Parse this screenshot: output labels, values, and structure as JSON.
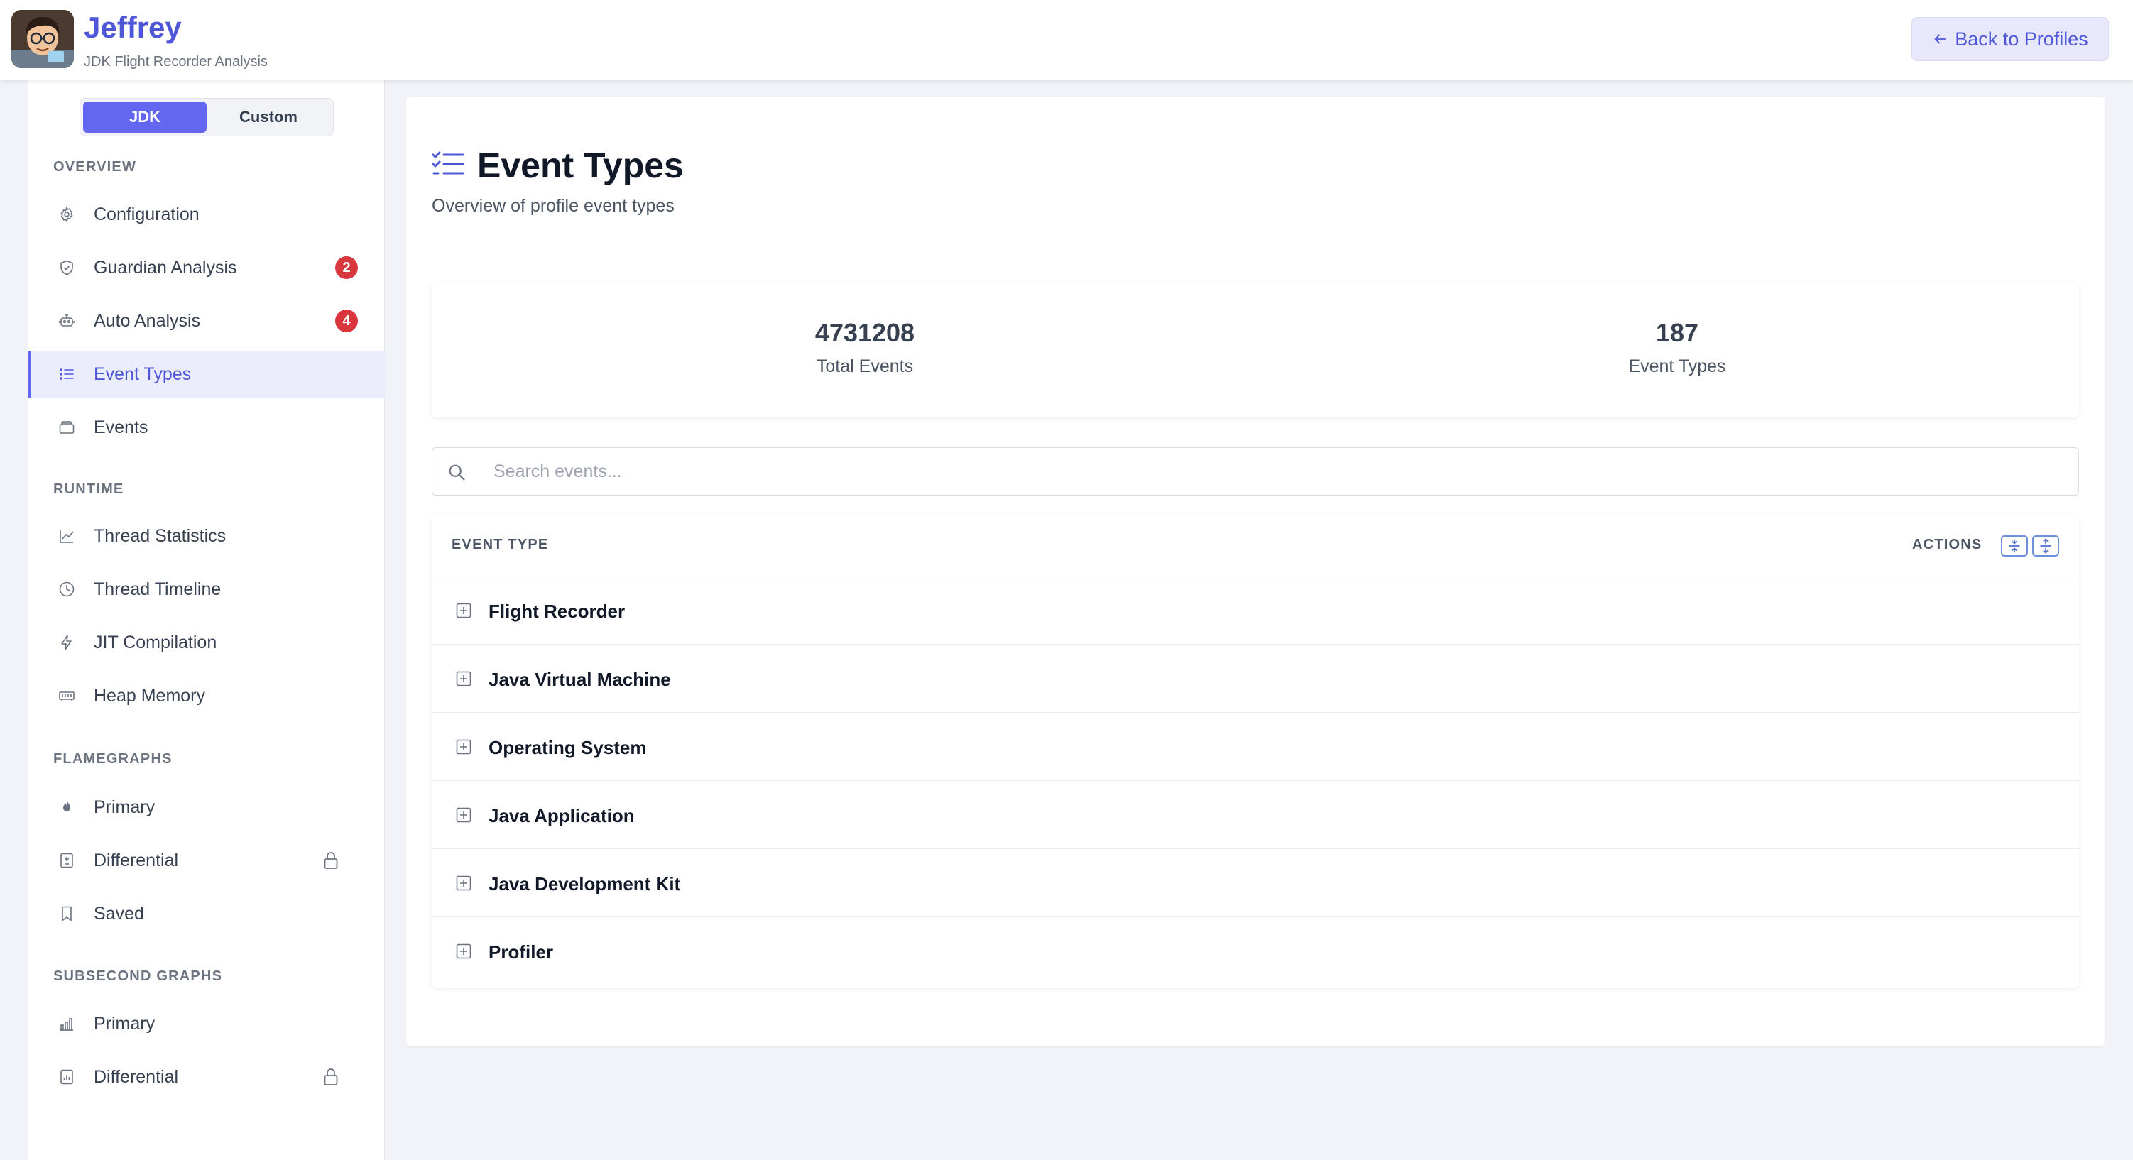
{
  "header": {
    "app_title": "Jeffrey",
    "app_subtitle": "JDK Flight Recorder Analysis",
    "back_button": "Back to Profiles"
  },
  "sidebar": {
    "mode_toggle": [
      "JDK",
      "Custom"
    ],
    "active_mode": "JDK",
    "sections": [
      {
        "title": "OVERVIEW",
        "items": [
          {
            "label": "Configuration",
            "icon": "gear-icon"
          },
          {
            "label": "Guardian Analysis",
            "icon": "shield-icon",
            "badge": "2"
          },
          {
            "label": "Auto Analysis",
            "icon": "robot-icon",
            "badge": "4"
          },
          {
            "label": "Event Types",
            "icon": "list-icon",
            "active": true
          },
          {
            "label": "Events",
            "icon": "folder-icon"
          }
        ]
      },
      {
        "title": "RUNTIME",
        "items": [
          {
            "label": "Thread Statistics",
            "icon": "line-chart-icon"
          },
          {
            "label": "Thread Timeline",
            "icon": "clock-icon"
          },
          {
            "label": "JIT Compilation",
            "icon": "lightning-icon"
          },
          {
            "label": "Heap Memory",
            "icon": "memory-icon"
          }
        ]
      },
      {
        "title": "FLAMEGRAPHS",
        "items": [
          {
            "label": "Primary",
            "icon": "flame-icon"
          },
          {
            "label": "Differential",
            "icon": "file-diff-icon",
            "locked": true
          },
          {
            "label": "Saved",
            "icon": "bookmark-icon"
          }
        ]
      },
      {
        "title": "SUBSECOND GRAPHS",
        "items": [
          {
            "label": "Primary",
            "icon": "bar-chart-icon"
          },
          {
            "label": "Differential",
            "icon": "file-bar-chart-icon",
            "locked": true
          }
        ]
      }
    ]
  },
  "main": {
    "title": "Event Types",
    "subtitle": "Overview of profile event types",
    "stats": [
      {
        "value": "4731208",
        "label": "Total Events"
      },
      {
        "value": "187",
        "label": "Event Types"
      }
    ],
    "search": {
      "placeholder": "Search events...",
      "value": ""
    },
    "table": {
      "columns": [
        "EVENT TYPE",
        "ACTIONS"
      ],
      "rows": [
        "Flight Recorder",
        "Java Virtual Machine",
        "Operating System",
        "Java Application",
        "Java Development Kit",
        "Profiler"
      ]
    }
  },
  "colors": {
    "accent": "#6366f1",
    "brand_text": "#4f57d9",
    "badge": "#d9363e",
    "background": "#f1f3f8"
  }
}
